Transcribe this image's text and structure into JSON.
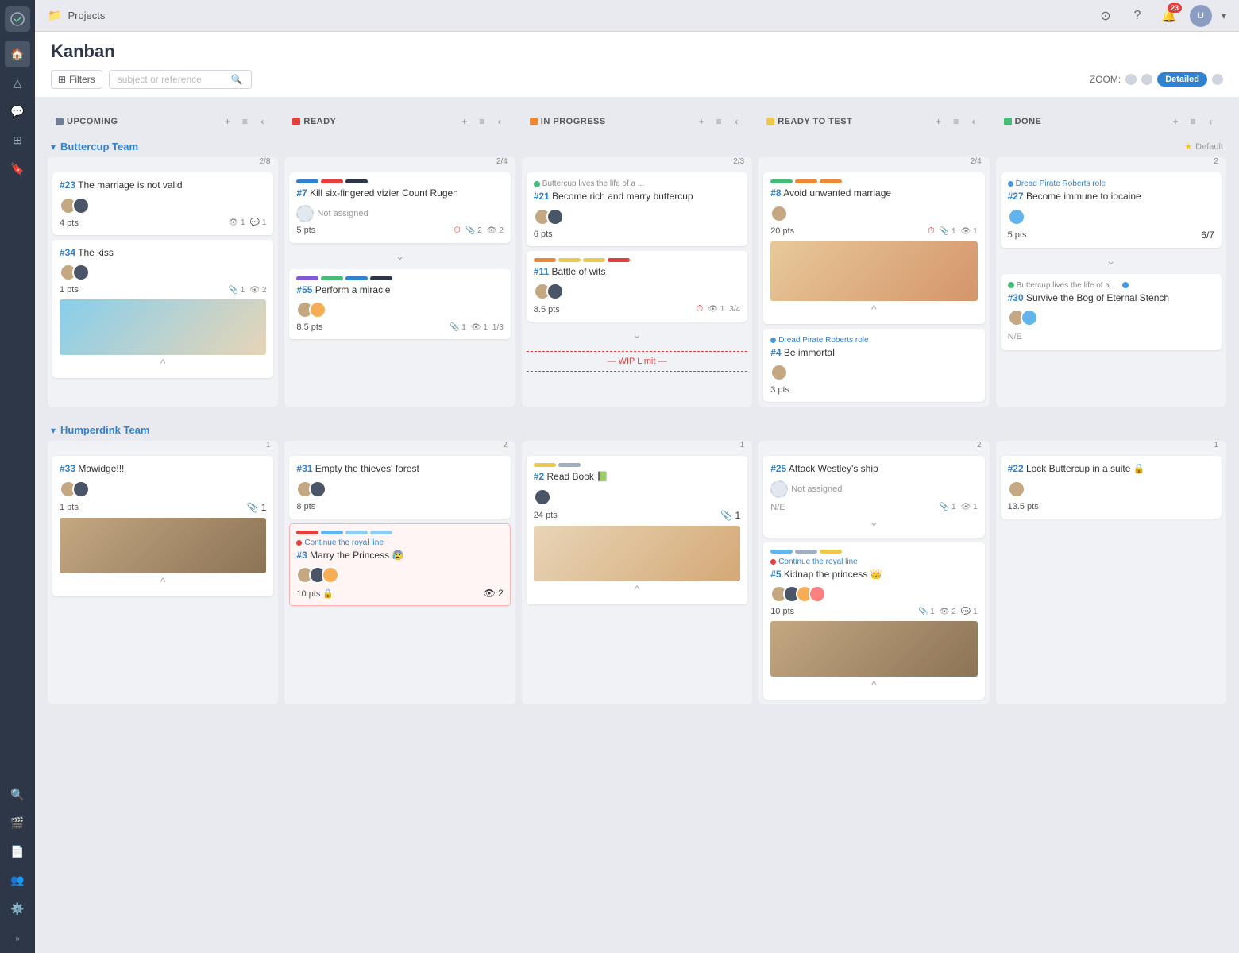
{
  "topbar": {
    "project_label": "Projects",
    "page_title": "Kanban"
  },
  "toolbar": {
    "filter_label": "Filters",
    "search_placeholder": "subject or reference",
    "zoom_label": "ZOOM:",
    "zoom_active": "Detailed"
  },
  "columns": [
    {
      "id": "upcoming",
      "title": "UPCOMING",
      "color": "#718096",
      "count": "2/8"
    },
    {
      "id": "ready",
      "title": "READY",
      "color": "#e53e3e",
      "count": "2/4"
    },
    {
      "id": "in-progress",
      "title": "IN PROGRESS",
      "color": "#ed8936",
      "count": "2/3"
    },
    {
      "id": "ready-to-test",
      "title": "READY TO TEST",
      "color": "#ecc94b",
      "count": "2/4"
    },
    {
      "id": "done",
      "title": "DONE",
      "color": "#48bb78",
      "count": "2"
    }
  ],
  "teams": [
    {
      "name": "Buttercup Team",
      "show_default": true,
      "cards": {
        "upcoming": [
          {
            "id": "23",
            "title": "The marriage is not valid",
            "pts": "4 pts",
            "avatars": [
              "brown",
              "dark"
            ],
            "views": "1",
            "comments": "1",
            "tags": [],
            "role": null,
            "meta": null,
            "image": null,
            "na": null,
            "sub": null,
            "highlighted": false
          },
          {
            "id": "34",
            "title": "The kiss",
            "pts": "1 pts",
            "avatars": [
              "brown",
              "dark"
            ],
            "views": null,
            "comments": null,
            "clips": "1",
            "eyes": "2",
            "tags": [],
            "role": null,
            "meta": null,
            "image": "kiss",
            "na": null,
            "sub": null,
            "highlighted": false
          }
        ],
        "ready": [
          {
            "id": "7",
            "title": "Kill six-fingered vizier Count Rugen",
            "pts": "5 pts",
            "avatars": [],
            "not_assigned": true,
            "views": null,
            "comments": null,
            "clips": "2",
            "eyes": "2",
            "tags": [
              "#3182ce",
              "#e53e3e",
              "#2d3748"
            ],
            "role": null,
            "meta": null,
            "image": null,
            "timer": true,
            "na": null,
            "sub": null,
            "highlighted": false
          },
          {
            "id": "55",
            "title": "Perform a miracle",
            "pts": "8.5 pts",
            "avatars": [
              "brown",
              "orange"
            ],
            "views": null,
            "comments": null,
            "clips": "1",
            "eyes": "1",
            "sub_count": "1/3",
            "tags": [
              "#805ad5",
              "#48bb78",
              "#3182ce",
              "#2d3748"
            ],
            "role": null,
            "meta": null,
            "image": null,
            "na": null,
            "highlighted": false
          }
        ],
        "in_progress": [
          {
            "id": "21",
            "title": "Become rich and marry buttercup",
            "pts": "6 pts",
            "avatars": [
              "brown",
              "dark"
            ],
            "views": null,
            "comments": null,
            "tags": [],
            "role": null,
            "meta": "Buttercup lives the life of a ...",
            "meta_dot": "green",
            "image": null,
            "na": null,
            "highlighted": false
          },
          {
            "id": "11",
            "title": "Battle of wits",
            "pts": "8.5 pts",
            "avatars": [
              "brown",
              "dark"
            ],
            "views": "1",
            "comments": null,
            "sub_count": "3/4",
            "timer": true,
            "tags": [
              "#ed8936",
              "#ecc94b",
              "#ecc94b",
              "#e53e3e"
            ],
            "role": null,
            "meta": null,
            "image": null,
            "na": null,
            "highlighted": false
          }
        ],
        "ready_to_test": [
          {
            "id": "8",
            "title": "Avoid unwanted marriage",
            "pts": "20 pts",
            "avatars": [
              "brown"
            ],
            "views": "1",
            "eyes": "1",
            "timer": true,
            "tags": [
              "#48bb78",
              "#ed8936",
              "#ed8936"
            ],
            "role": null,
            "meta": null,
            "image": "girl",
            "na": null,
            "highlighted": false
          },
          {
            "id": "4",
            "title": "Be immortal",
            "pts": "3 pts",
            "avatars": [
              "brown"
            ],
            "views": null,
            "comments": null,
            "tags": [],
            "role": "Dread Pirate Roberts role",
            "role_dot": "blue",
            "meta": null,
            "image": null,
            "na": null,
            "highlighted": false
          }
        ],
        "done": [
          {
            "id": "27",
            "title": "Become immune to iocaine",
            "pts": "5 pts",
            "avatars": [
              "blue"
            ],
            "sub_count": "6/7",
            "tags": [],
            "role": "Dread Pirate Roberts role",
            "role_dot": "blue",
            "meta": null,
            "image": null,
            "na": null,
            "highlighted": false
          },
          {
            "id": "30",
            "title": "Survive the Bog of Eternal Stench",
            "pts": null,
            "avatars": [
              "brown",
              "blue"
            ],
            "na_text": "N/E",
            "tags": [],
            "role": null,
            "meta": "Buttercup lives the life of a ...",
            "meta_dot": "green",
            "meta_dot2": "blue",
            "image": null,
            "na": null,
            "highlighted": false
          }
        ]
      }
    },
    {
      "name": "Humperdink Team",
      "show_default": false,
      "cards": {
        "upcoming": [
          {
            "id": "33",
            "title": "Mawidge!!!",
            "pts": "1 pts",
            "avatars": [
              "brown",
              "dark"
            ],
            "clips": "1",
            "tags": [],
            "role": null,
            "meta": null,
            "image": "prince",
            "na": null,
            "highlighted": false
          }
        ],
        "ready": [
          {
            "id": "31",
            "title": "Empty the thieves' forest",
            "pts": "8 pts",
            "avatars": [
              "brown",
              "dark"
            ],
            "tags": [],
            "role": null,
            "meta": null,
            "image": null,
            "na": null,
            "highlighted": false
          },
          {
            "id": "3",
            "title": "Marry the Princess 😰",
            "pts": "10 pts",
            "avatars": [
              "brown",
              "dark",
              "orange"
            ],
            "eyes": "2",
            "tags": [
              "#e53e3e",
              "#63b3ed",
              "#90cdf4",
              "#90cdf4"
            ],
            "role": "Continue the royal line",
            "role_dot": "red",
            "meta": null,
            "image": null,
            "na": null,
            "lock": true,
            "highlighted": true
          }
        ],
        "in_progress": [
          {
            "id": "2",
            "title": "Read Book 📗",
            "pts": "24 pts",
            "avatars": [
              "dark"
            ],
            "clips": "1",
            "tags": [
              "#ecc94b",
              "#a0aec0"
            ],
            "role": null,
            "meta": null,
            "image": "reader",
            "na": null,
            "highlighted": false
          }
        ],
        "ready_to_test": [
          {
            "id": "25",
            "title": "Attack Westley's ship",
            "pts": null,
            "avatars": [],
            "not_assigned": true,
            "clips": "1",
            "eyes": "1",
            "tags": [],
            "role": null,
            "meta": null,
            "image": null,
            "na_text": "N/E",
            "highlighted": false
          },
          {
            "id": "5",
            "title": "Kidnap the princess 👑",
            "pts": "10 pts",
            "avatars": [
              "brown",
              "dark",
              "orange",
              "red"
            ],
            "clips": "1",
            "eyes": "2",
            "comments": "1",
            "tags": [
              "#63b3ed",
              "#a0aec0",
              "#ecc94b"
            ],
            "role": "Continue the royal line",
            "role_dot": "red",
            "meta": null,
            "image": "prince2",
            "na": null,
            "highlighted": false
          }
        ],
        "done": [
          {
            "id": "22",
            "title": "Lock Buttercup in a suite 🔒",
            "pts": "13.5 pts",
            "avatars": [
              "brown"
            ],
            "tags": [],
            "role": null,
            "meta": null,
            "image": null,
            "na": null,
            "highlighted": false
          }
        ]
      }
    }
  ]
}
